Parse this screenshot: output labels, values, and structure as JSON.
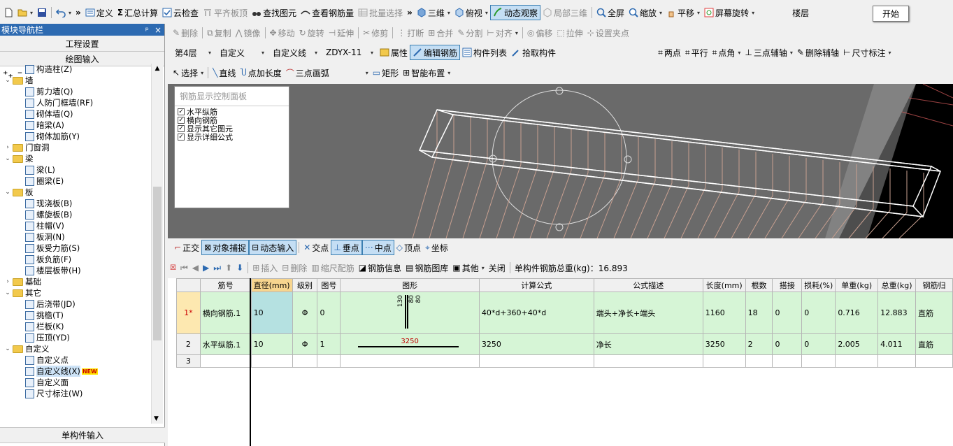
{
  "main_toolbar": {
    "items": [
      {
        "label": "",
        "icon": "new-file-icon",
        "disabled": false
      },
      {
        "label": "",
        "icon": "open-folder-icon",
        "disabled": false
      },
      {
        "label": "",
        "icon": "save-icon",
        "disabled": false
      },
      {
        "label": "",
        "icon": "undo-icon",
        "disabled": false
      },
      {
        "label": "定义",
        "icon": "define-icon",
        "disabled": false
      },
      {
        "label": "汇总计算",
        "icon": "sum-icon",
        "disabled": false
      },
      {
        "label": "云检查",
        "icon": "cloud-check-icon",
        "disabled": false
      },
      {
        "label": "平齐板顶",
        "icon": "align-top-icon",
        "disabled": true
      },
      {
        "label": "查找图元",
        "icon": "binoculars-icon",
        "disabled": false
      },
      {
        "label": "查看钢筋量",
        "icon": "rebar-quantity-icon",
        "disabled": false
      },
      {
        "label": "批量选择",
        "icon": "batch-select-icon",
        "disabled": true
      },
      {
        "label": "三维",
        "icon": "cube-3d-icon",
        "disabled": false
      },
      {
        "label": "俯视",
        "icon": "top-view-icon",
        "disabled": false
      },
      {
        "label": "动态观察",
        "icon": "orbit-icon",
        "disabled": false
      },
      {
        "label": "局部三维",
        "icon": "local-3d-icon",
        "disabled": true
      },
      {
        "label": "全屏",
        "icon": "fullscreen-icon",
        "disabled": false
      },
      {
        "label": "缩放",
        "icon": "zoom-icon",
        "disabled": false
      },
      {
        "label": "平移",
        "icon": "pan-icon",
        "disabled": false
      },
      {
        "label": "屏幕旋转",
        "icon": "rotate-screen-icon",
        "disabled": false
      },
      {
        "label": "楼层",
        "icon": "",
        "disabled": false
      }
    ],
    "start_button": "开始"
  },
  "nav_panel": {
    "title": "模块导航栏",
    "pin": "ᵖ",
    "close": "×",
    "project_settings": "工程设置",
    "drawing_input": "绘图输入",
    "single_input": "单构件输入",
    "tree": [
      {
        "label": "构造柱(Z)",
        "level": 2,
        "type": "item"
      },
      {
        "label": "墙",
        "level": 1,
        "type": "folder",
        "expanded": true
      },
      {
        "label": "剪力墙(Q)",
        "level": 2,
        "type": "item"
      },
      {
        "label": "人防门框墙(RF)",
        "level": 2,
        "type": "item"
      },
      {
        "label": "砌体墙(Q)",
        "level": 2,
        "type": "item"
      },
      {
        "label": "暗梁(A)",
        "level": 2,
        "type": "item"
      },
      {
        "label": "砌体加筋(Y)",
        "level": 2,
        "type": "item"
      },
      {
        "label": "门窗洞",
        "level": 1,
        "type": "folder",
        "expanded": false
      },
      {
        "label": "梁",
        "level": 1,
        "type": "folder",
        "expanded": true
      },
      {
        "label": "梁(L)",
        "level": 2,
        "type": "item"
      },
      {
        "label": "圈梁(E)",
        "level": 2,
        "type": "item"
      },
      {
        "label": "板",
        "level": 1,
        "type": "folder",
        "expanded": true
      },
      {
        "label": "现浇板(B)",
        "level": 2,
        "type": "item"
      },
      {
        "label": "螺旋板(B)",
        "level": 2,
        "type": "item"
      },
      {
        "label": "柱帽(V)",
        "level": 2,
        "type": "item"
      },
      {
        "label": "板洞(N)",
        "level": 2,
        "type": "item"
      },
      {
        "label": "板受力筋(S)",
        "level": 2,
        "type": "item"
      },
      {
        "label": "板负筋(F)",
        "level": 2,
        "type": "item"
      },
      {
        "label": "楼层板带(H)",
        "level": 2,
        "type": "item"
      },
      {
        "label": "基础",
        "level": 1,
        "type": "folder",
        "expanded": false
      },
      {
        "label": "其它",
        "level": 1,
        "type": "folder",
        "expanded": true
      },
      {
        "label": "后浇带(JD)",
        "level": 2,
        "type": "item"
      },
      {
        "label": "挑檐(T)",
        "level": 2,
        "type": "item"
      },
      {
        "label": "栏板(K)",
        "level": 2,
        "type": "item"
      },
      {
        "label": "压顶(YD)",
        "level": 2,
        "type": "item"
      },
      {
        "label": "自定义",
        "level": 1,
        "type": "folder",
        "expanded": true
      },
      {
        "label": "自定义点",
        "level": 2,
        "type": "item"
      },
      {
        "label": "自定义线(X)",
        "level": 2,
        "type": "item",
        "selected": true,
        "badge": "NEW"
      },
      {
        "label": "自定义面",
        "level": 2,
        "type": "item"
      },
      {
        "label": "尺寸标注(W)",
        "level": 2,
        "type": "item"
      }
    ]
  },
  "edit_toolbar": [
    "删除",
    "复制",
    "镜像",
    "移动",
    "旋转",
    "延伸",
    "修剪",
    "打断",
    "合并",
    "分割",
    "对齐",
    "偏移",
    "拉伸",
    "设置夹点"
  ],
  "layer_toolbar": {
    "floor": "第4层",
    "category": "自定义",
    "type": "自定义线",
    "component": "ZDYX-11",
    "buttons": [
      "属性",
      "编辑钢筋",
      "构件列表",
      "拾取构件"
    ],
    "right_buttons": [
      "两点",
      "平行",
      "点角",
      "三点辅轴",
      "删除辅轴",
      "尺寸标注"
    ]
  },
  "draw_toolbar": {
    "select": "选择",
    "buttons": [
      "直线",
      "点加长度",
      "三点画弧"
    ],
    "rect": "矩形",
    "smart": "智能布置"
  },
  "rebar_panel": {
    "title": "钢筋显示控制面板",
    "options": [
      {
        "label": "水平纵筋",
        "checked": true
      },
      {
        "label": "横向钢筋",
        "checked": true
      },
      {
        "label": "显示其它图元",
        "checked": true
      },
      {
        "label": "显示详细公式",
        "checked": true
      }
    ]
  },
  "snap_toolbar": [
    "正交",
    "对象捕捉",
    "动态输入",
    "交点",
    "垂点",
    "中点",
    "顶点",
    "坐标"
  ],
  "table_toolbar": {
    "buttons": [
      "插入",
      "删除",
      "缩尺配筋",
      "钢筋信息",
      "钢筋图库",
      "其他",
      "关闭"
    ],
    "total_label": "单构件钢筋总重(kg)：16.893"
  },
  "rebar_table": {
    "headers": [
      "",
      "筋号",
      "直径(mm)",
      "级别",
      "图号",
      "图形",
      "计算公式",
      "公式描述",
      "长度(mm)",
      "根数",
      "搭接",
      "损耗(%)",
      "单重(kg)",
      "总重(kg)",
      "钢筋归"
    ],
    "rows": [
      {
        "no": "1*",
        "name": "横向钢筋.1",
        "diameter": "10",
        "grade": "Φ",
        "fig_no": "0",
        "shape_values": [
          "130",
          "80",
          "80"
        ],
        "formula": "40*d+360+40*d",
        "desc": "端头+净长+端头",
        "length": "1160",
        "count": "18",
        "lap": "0",
        "loss": "0",
        "unit_w": "0.716",
        "total_w": "12.883",
        "cls": "直筋"
      },
      {
        "no": "2",
        "name": "水平纵筋.1",
        "diameter": "10",
        "grade": "Φ",
        "fig_no": "1",
        "shape_values": [
          "3250"
        ],
        "formula": "3250",
        "desc": "净长",
        "length": "3250",
        "count": "2",
        "lap": "0",
        "loss": "0",
        "unit_w": "2.005",
        "total_w": "4.011",
        "cls": "直筋"
      },
      {
        "no": "3",
        "name": "",
        "diameter": "",
        "grade": "",
        "fig_no": "",
        "shape_values": [],
        "formula": "",
        "desc": "",
        "length": "",
        "count": "",
        "lap": "",
        "loss": "",
        "unit_w": "",
        "total_w": "",
        "cls": ""
      }
    ]
  },
  "colors": {
    "nav_title": "#2d6ab1",
    "row_green": "#d6f5d6",
    "selected_cell": "#b5e1e1",
    "header_highlight": "#f7d58f",
    "shape_label": "#c00000"
  }
}
